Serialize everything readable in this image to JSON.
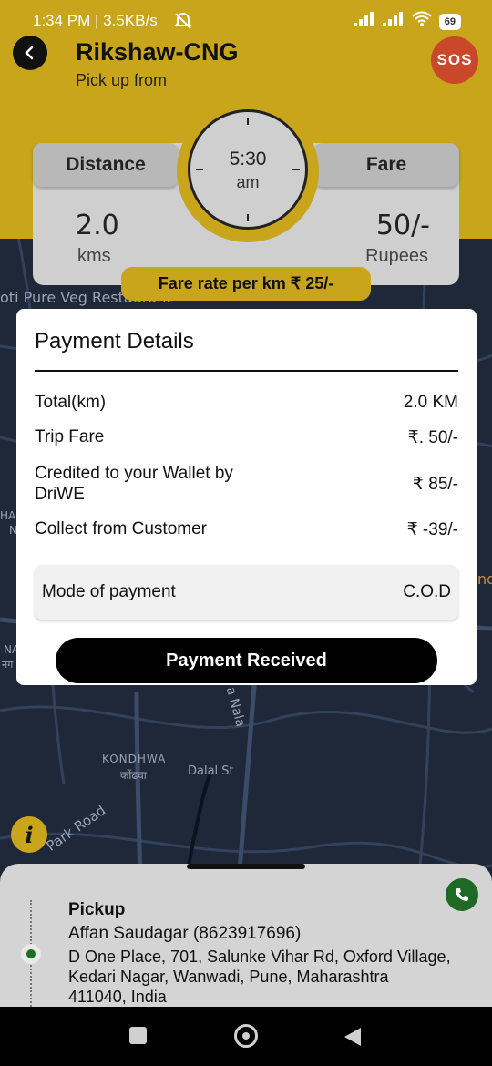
{
  "status_bar": {
    "time_speed": "1:34 PM | 3.5KB/s",
    "battery": "69"
  },
  "header": {
    "title": "Rikshaw-CNG",
    "subtitle": "Pick up from",
    "sos_label": "SOS"
  },
  "stats": {
    "distance_label": "Distance",
    "distance_value": "2.0",
    "distance_unit": "kms",
    "fare_label": "Fare",
    "fare_value": "50/-",
    "fare_unit": "Rupees",
    "clock_time": "5:30",
    "clock_ampm": "am",
    "fare_rate": "Fare rate per km ₹ 25/-"
  },
  "map": {
    "labels": [
      "oti Pure Veg Restaurant",
      "KONDHWA",
      "कोंढवा",
      "Dalal St",
      "Park Road",
      "a Nala",
      "nd",
      "HA",
      "N",
      "NA",
      "नग"
    ]
  },
  "payment": {
    "title": "Payment Details",
    "rows": [
      {
        "label": "Total(km)",
        "value": "2.0 KM"
      },
      {
        "label": "Trip Fare",
        "value": "₹. 50/-"
      },
      {
        "label": "Credited to your Wallet by DriWE",
        "value": "₹ 85/-"
      },
      {
        "label": "Collect from Customer",
        "value": "₹ -39/-"
      }
    ],
    "mode_label": "Mode of payment",
    "mode_value": "C.O.D",
    "button_label": "Payment Received"
  },
  "info_icon": "i",
  "pickup": {
    "title": "Pickup",
    "name": "Affan Saudagar (8623917696)",
    "address": "D One Place, 701, Salunke Vihar Rd, Oxford Village, Kedari Nagar, Wanwadi, Pune, Maharashtra 411040, India"
  },
  "icons": [
    "back-arrow-icon",
    "mute-icon",
    "signal-icon",
    "wifi-icon",
    "battery-icon",
    "phone-icon",
    "info-icon",
    "recents-icon",
    "home-icon",
    "back-triangle-icon"
  ],
  "colors": {
    "accent_yellow": "#c9a51c",
    "sos_red": "#c9482a",
    "call_green": "#1e6a24",
    "map_bg": "#1e2839"
  }
}
